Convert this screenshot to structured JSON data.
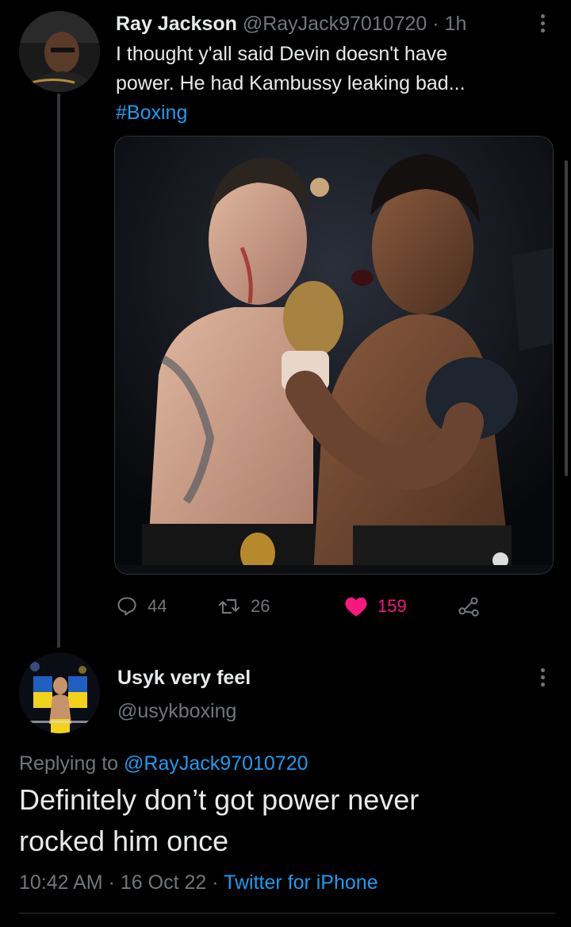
{
  "tweet1": {
    "display_name": "Ray Jackson",
    "handle": "@RayJack97010720",
    "separator": "·",
    "time_ago": "1h",
    "text_line1": "I thought y'all said Devin doesn't have",
    "text_line2": "power. He had Kambussy leaking bad...",
    "hashtag": "#Boxing",
    "media_icon": "boxing-photo",
    "stats": {
      "replies": "44",
      "retweets": "26",
      "likes": "159"
    },
    "liked": true
  },
  "tweet2": {
    "display_name": "Usyk very feel",
    "handle": "@usykboxing",
    "replying_prefix": "Replying to",
    "replying_to": "@RayJack97010720",
    "text_line1": "Definitely don’t got power never",
    "text_line2": "rocked him once",
    "time": "10:42 AM",
    "separator1": "·",
    "date": "16 Oct 22",
    "separator2": "·",
    "source": "Twitter for iPhone"
  },
  "colors": {
    "background": "#000000",
    "text": "#e7e9ea",
    "muted": "#71767b",
    "accent": "#1d9bf0",
    "like": "#f91880"
  },
  "icons": [
    "reply-icon",
    "retweet-icon",
    "heart-icon",
    "share-icon",
    "more-icon"
  ]
}
